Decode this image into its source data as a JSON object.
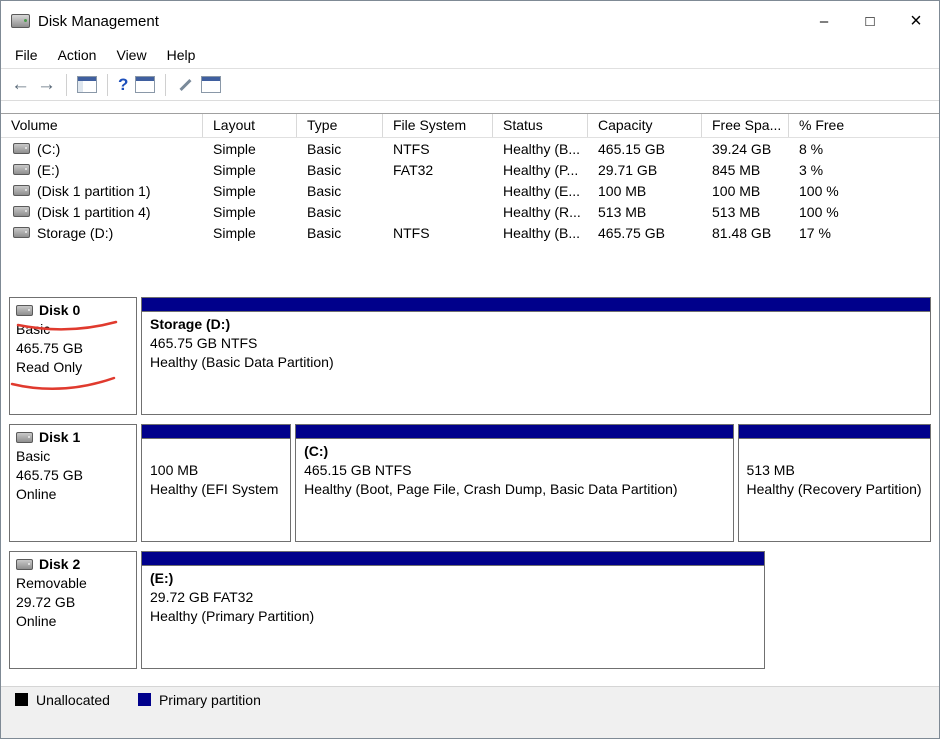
{
  "window": {
    "title": "Disk Management",
    "controls": {
      "minimize": "–",
      "maximize": "□",
      "close": "×"
    }
  },
  "menu": {
    "file": "File",
    "action": "Action",
    "view": "View",
    "help": "Help"
  },
  "toolbar": {
    "icons": [
      "back",
      "forward",
      "show-console-tree",
      "help",
      "properties",
      "launch-tool",
      "action-window"
    ]
  },
  "volume_list": {
    "columns": {
      "volume": "Volume",
      "layout": "Layout",
      "type": "Type",
      "file_system": "File System",
      "status": "Status",
      "capacity": "Capacity",
      "free_space": "Free Spa...",
      "pct_free": "% Free"
    },
    "rows": [
      {
        "volume": "(C:)",
        "layout": "Simple",
        "type": "Basic",
        "file_system": "NTFS",
        "status": "Healthy (B...",
        "capacity": "465.15 GB",
        "free_space": "39.24 GB",
        "pct_free": "8 %"
      },
      {
        "volume": "(E:)",
        "layout": "Simple",
        "type": "Basic",
        "file_system": "FAT32",
        "status": "Healthy (P...",
        "capacity": "29.71 GB",
        "free_space": "845 MB",
        "pct_free": "3 %"
      },
      {
        "volume": "(Disk 1 partition 1)",
        "layout": "Simple",
        "type": "Basic",
        "file_system": "",
        "status": "Healthy (E...",
        "capacity": "100 MB",
        "free_space": "100 MB",
        "pct_free": "100 %"
      },
      {
        "volume": "(Disk 1 partition 4)",
        "layout": "Simple",
        "type": "Basic",
        "file_system": "",
        "status": "Healthy (R...",
        "capacity": "513 MB",
        "free_space": "513 MB",
        "pct_free": "100 %"
      },
      {
        "volume": "Storage (D:)",
        "layout": "Simple",
        "type": "Basic",
        "file_system": "NTFS",
        "status": "Healthy (B...",
        "capacity": "465.75 GB",
        "free_space": "81.48 GB",
        "pct_free": "17 %"
      }
    ]
  },
  "disks": [
    {
      "name": "Disk 0",
      "kind": "Basic",
      "size": "465.75 GB",
      "status": "Read Only",
      "partitions": [
        {
          "title": "Storage  (D:)",
          "detail": "465.75 GB NTFS",
          "health": "Healthy (Basic Data Partition)"
        }
      ]
    },
    {
      "name": "Disk 1",
      "kind": "Basic",
      "size": "465.75 GB",
      "status": "Online",
      "partitions": [
        {
          "title": "",
          "detail": "100 MB",
          "health": "Healthy (EFI System"
        },
        {
          "title": "(C:)",
          "detail": "465.15 GB NTFS",
          "health": "Healthy (Boot, Page File, Crash Dump, Basic Data Partition)"
        },
        {
          "title": "",
          "detail": "513 MB",
          "health": "Healthy (Recovery Partition)"
        }
      ]
    },
    {
      "name": "Disk 2",
      "kind": "Removable",
      "size": "29.72 GB",
      "status": "Online",
      "partitions": [
        {
          "title": "(E:)",
          "detail": "29.72 GB FAT32",
          "health": "Healthy (Primary Partition)"
        }
      ]
    }
  ],
  "legend": {
    "unallocated_label": "Unallocated",
    "primary_label": "Primary partition",
    "unallocated_color": "#000000",
    "primary_color": "#00008b"
  },
  "annotation": {
    "color": "#e03a2e",
    "highlights": [
      "Disk 0",
      "Read Only"
    ]
  }
}
